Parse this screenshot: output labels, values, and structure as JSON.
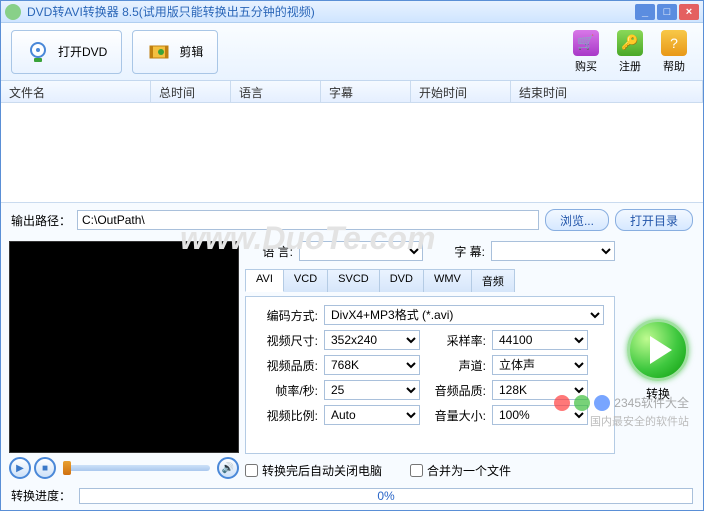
{
  "title": "DVD转AVI转换器 8.5(试用版只能转换出五分钟的视频)",
  "toolbar": {
    "open_dvd": "打开DVD",
    "edit": "剪辑"
  },
  "right_buttons": {
    "buy": "购买",
    "register": "注册",
    "help": "帮助"
  },
  "columns": {
    "filename": "文件名",
    "total_time": "总时间",
    "language": "语言",
    "subtitle": "字幕",
    "start_time": "开始时间",
    "end_time": "结束时间"
  },
  "output": {
    "label": "输出路径：",
    "path": "C:\\OutPath\\",
    "browse": "浏览...",
    "open_dir": "打开目录"
  },
  "watermark": "www.DuoTe.com",
  "lang_row": {
    "language": "语   言:",
    "subtitle": "字  幕:"
  },
  "tabs": [
    "AVI",
    "VCD",
    "SVCD",
    "DVD",
    "WMV",
    "音频"
  ],
  "panel": {
    "encode_label": "编码方式:",
    "encode_value": "DivX4+MP3格式 (*.avi)",
    "size_label": "视频尺寸:",
    "size_value": "352x240",
    "sample_label": "采样率:",
    "sample_value": "44100",
    "vquality_label": "视频品质:",
    "vquality_value": "768K",
    "channel_label": "声道:",
    "channel_value": "立体声",
    "fps_label": "帧率/秒:",
    "fps_value": "25",
    "aquality_label": "音频品质:",
    "aquality_value": "128K",
    "ratio_label": "视频比例:",
    "ratio_value": "Auto",
    "volume_label": "音量大小:",
    "volume_value": "100%"
  },
  "checks": {
    "shutdown": "转换完后自动关闭电脑",
    "merge": "合并为一个文件"
  },
  "convert": "转换",
  "progress": {
    "label": "转换进度：",
    "value": "0%"
  },
  "footer_wm": "国内最安全的软件站",
  "logo2345": "2345软件大全"
}
